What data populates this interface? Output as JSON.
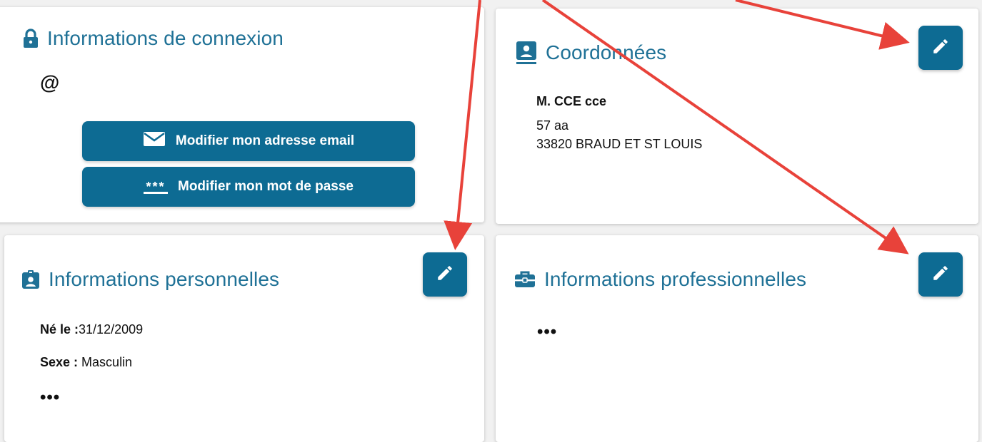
{
  "login": {
    "title": "Informations de connexion",
    "email_value": "@",
    "change_email_label": "Modifier mon adresse email",
    "change_password_label": "Modifier mon mot de passe",
    "password_mask_glyph": "***"
  },
  "contact": {
    "title": "Coordonnées",
    "name": "M. CCE cce",
    "address_line1": "57 aa",
    "address_line2": "33820 BRAUD ET ST LOUIS"
  },
  "personal": {
    "title": "Informations personnelles",
    "birth_label": "Né le :",
    "birth_value": "31/12/2009",
    "gender_label": "Sexe :",
    "gender_value": " Masculin",
    "more": "•••"
  },
  "professional": {
    "title": "Informations professionnelles",
    "more": "•••"
  },
  "icons": {
    "login_title": "lock-icon",
    "contact_title": "contact-card-icon",
    "personal_title": "id-badge-icon",
    "professional_title": "briefcase-icon",
    "edit": "pencil-icon",
    "email_button": "envelope-icon"
  },
  "colors": {
    "title": "#1f7196",
    "button": "#0d6b93",
    "annotation_arrow": "#e8423a"
  }
}
